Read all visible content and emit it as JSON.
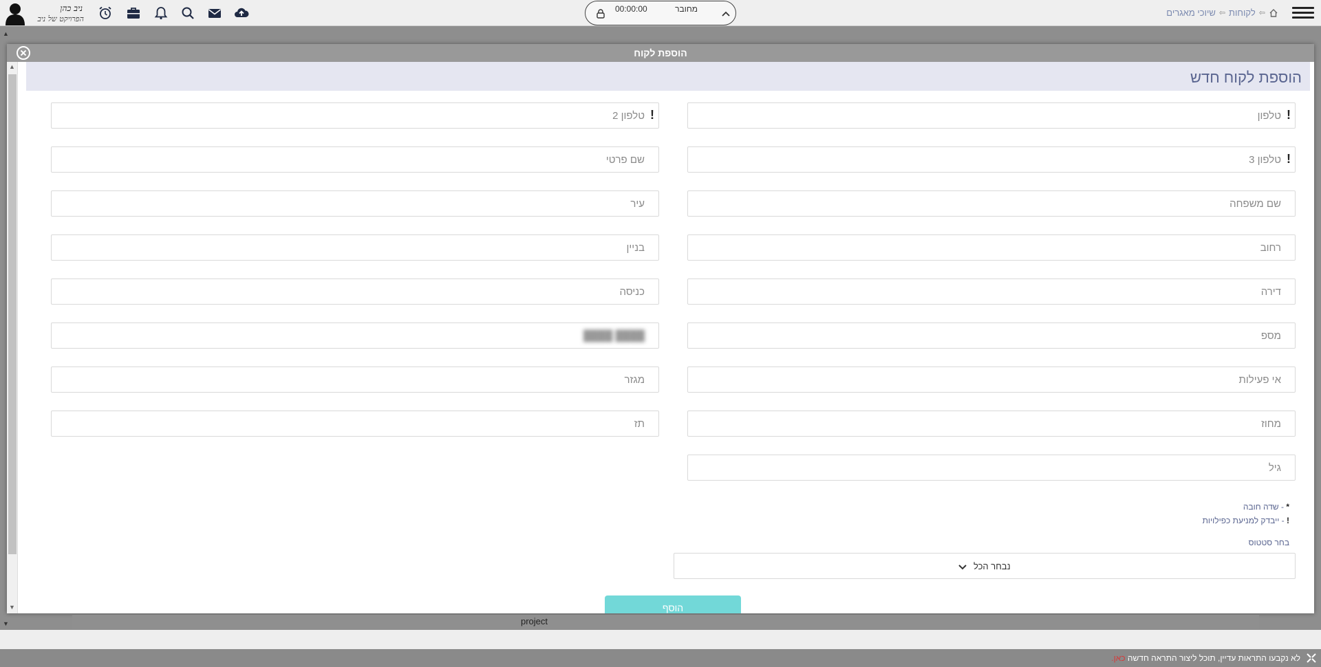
{
  "topbar": {
    "breadcrumb": [
      "שיוכי מאגרים",
      "לקוחות"
    ],
    "status": {
      "connection": "מחובר",
      "timer": "00:00:00"
    },
    "user": {
      "name": "ניב כהן",
      "project": "הפרויקט של ניב"
    },
    "icons": [
      "menu-icon",
      "home-icon",
      "cloud-upload-icon",
      "mail-icon",
      "search-icon",
      "bell-icon",
      "briefcase-icon",
      "alarm-clock-icon",
      "lock-icon",
      "chevron-up-icon",
      "user-avatar-icon"
    ]
  },
  "modal": {
    "title": "הוספת לקוח",
    "section_title": "הוספת לקוח חדש",
    "fields_right": [
      {
        "placeholder": "טלפון",
        "dedupe": true
      },
      {
        "placeholder": "טלפון 3",
        "dedupe": true
      },
      {
        "placeholder": "שם משפחה",
        "dedupe": false
      },
      {
        "placeholder": "רחוב",
        "dedupe": false
      },
      {
        "placeholder": "דירה",
        "dedupe": false
      },
      {
        "placeholder": "מספ",
        "dedupe": false
      },
      {
        "placeholder": "אי פעילות",
        "dedupe": false
      },
      {
        "placeholder": "מחוז",
        "dedupe": false
      },
      {
        "placeholder": "גיל",
        "dedupe": false
      }
    ],
    "fields_left": [
      {
        "placeholder": "טלפון 2",
        "dedupe": true
      },
      {
        "placeholder": "שם פרטי",
        "dedupe": false
      },
      {
        "placeholder": "עיר",
        "dedupe": false
      },
      {
        "placeholder": "בניין",
        "dedupe": false
      },
      {
        "placeholder": "כניסה",
        "dedupe": false
      },
      {
        "placeholder": "████ ████",
        "dedupe": false,
        "blurred": true
      },
      {
        "placeholder": "מגזר",
        "dedupe": false
      },
      {
        "placeholder": "תז",
        "dedupe": false
      }
    ],
    "legend": {
      "required_mark": "*",
      "required_text": "- שדה חובה",
      "dedupe_mark": "!",
      "dedupe_text": "- ייבדק למניעת כפילויות"
    },
    "status_label": "בחר סטטוס",
    "status_select_value": "נבחר הכל",
    "submit_label": "הוסף"
  },
  "background": {
    "table_cell": "project"
  },
  "footer": {
    "text": "לא נקבעו התראות עדיין, תוכל ליצור התראה חדשה",
    "link": "כאן."
  }
}
